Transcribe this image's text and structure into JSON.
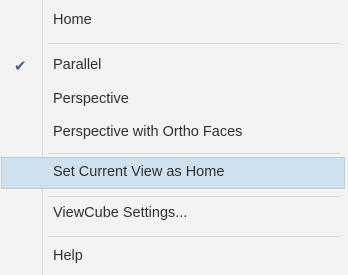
{
  "menu": {
    "home": "Home",
    "check_mark": "✔",
    "parallel": "Parallel",
    "perspective": "Perspective",
    "perspective_ortho": "Perspective with Ortho Faces",
    "set_current_view": "Set Current View as Home",
    "viewcube_settings": "ViewCube Settings...",
    "help": "Help"
  },
  "state": {
    "checked_item": "Parallel",
    "highlighted_item": "Set Current View as Home"
  },
  "colors": {
    "menu_background": "#f3f3f1",
    "highlight_background": "#cfe0ee",
    "check_color": "#4a5f86"
  }
}
